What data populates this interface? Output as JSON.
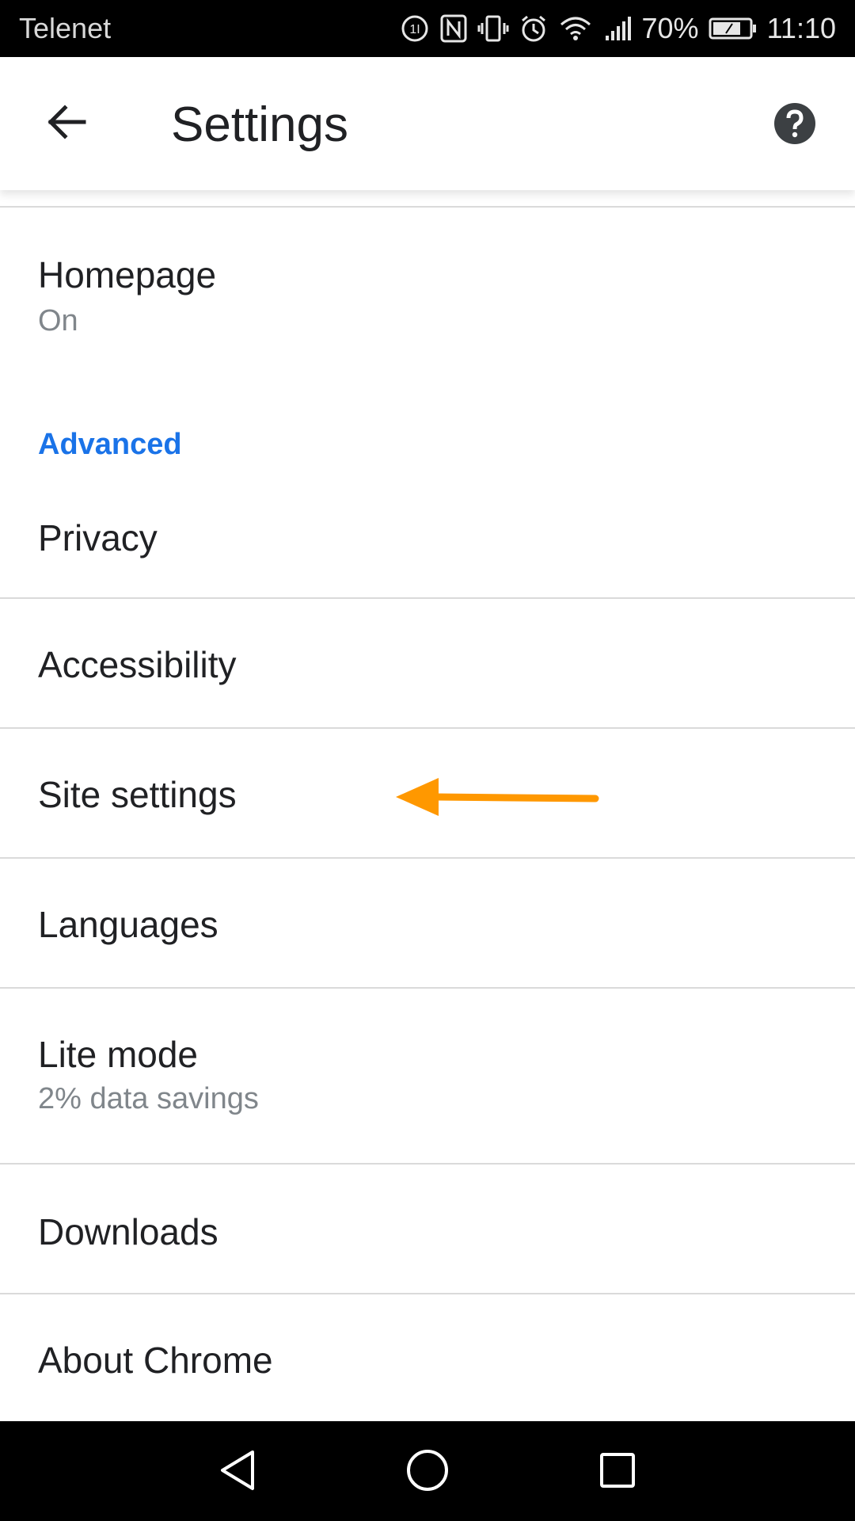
{
  "status_bar": {
    "carrier": "Telenet",
    "battery": "70%",
    "time": "11:10",
    "icons": [
      "data-saver-icon",
      "nfc-icon",
      "vibrate-icon",
      "alarm-icon",
      "wifi-icon",
      "signal-icon",
      "battery-icon"
    ]
  },
  "app_bar": {
    "title": "Settings",
    "back_icon": "back-arrow-icon",
    "help_icon": "help-icon"
  },
  "items": {
    "homepage": {
      "label": "Homepage",
      "sub": "On"
    },
    "advanced_header": "Advanced",
    "privacy": {
      "label": "Privacy"
    },
    "accessibility": {
      "label": "Accessibility"
    },
    "site_settings": {
      "label": "Site settings"
    },
    "languages": {
      "label": "Languages"
    },
    "lite_mode": {
      "label": "Lite mode",
      "sub": "2% data savings"
    },
    "downloads": {
      "label": "Downloads"
    },
    "about_chrome": {
      "label": "About Chrome"
    }
  },
  "annotation": {
    "color": "#FF9800",
    "icon": "left-arrow-annotation"
  },
  "colors": {
    "accent": "#1a73e8",
    "text": "#202124",
    "secondary": "#80868b"
  },
  "nav_bar": {
    "icons": [
      "back-triangle-icon",
      "home-circle-icon",
      "recents-square-icon"
    ]
  }
}
